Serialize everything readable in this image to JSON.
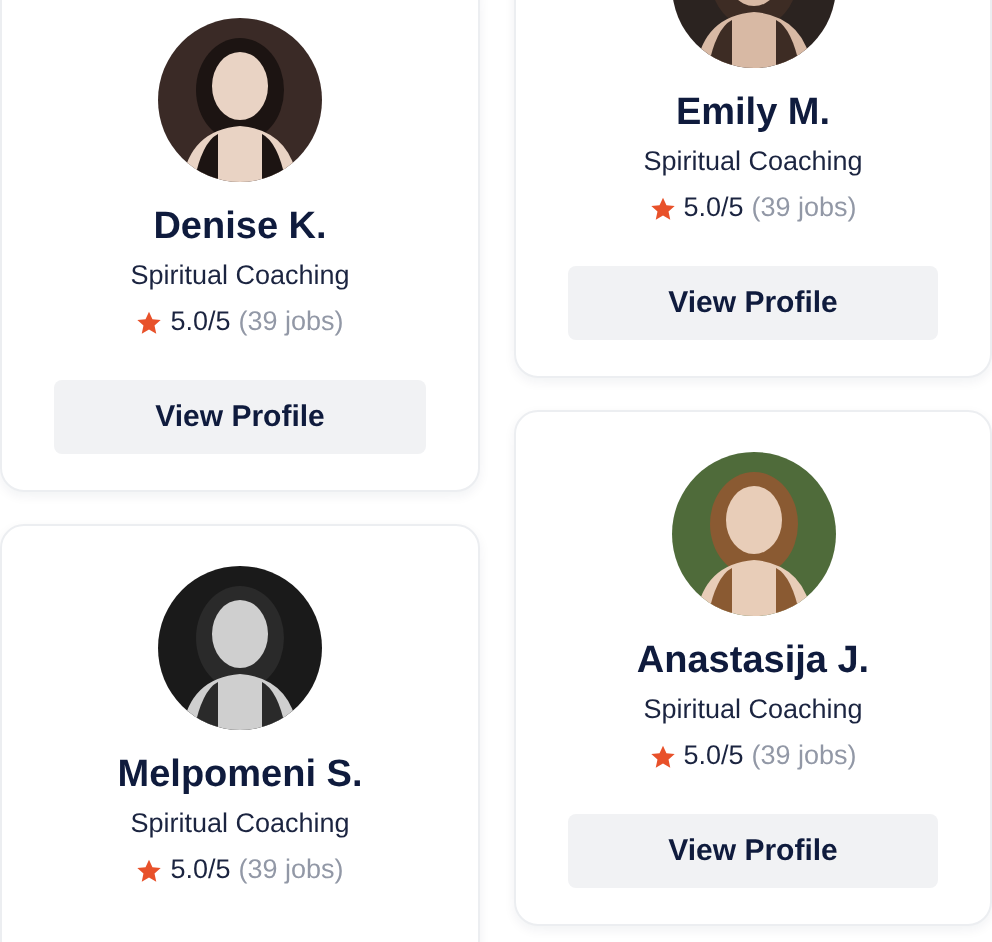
{
  "columns": [
    {
      "cards": [
        {
          "name": "Denise K.",
          "specialty": "Spiritual Coaching",
          "rating": "5.0/5",
          "jobs": "(39 jobs)",
          "button": "View Profile"
        },
        {
          "name": "Melpomeni S.",
          "specialty": "Spiritual Coaching",
          "rating": "5.0/5",
          "jobs": "(39 jobs)"
        }
      ]
    },
    {
      "cards": [
        {
          "name": "Emily M.",
          "specialty": "Spiritual Coaching",
          "rating": "5.0/5",
          "jobs": "(39 jobs)",
          "button": "View Profile"
        },
        {
          "name": "Anastasija J.",
          "specialty": "Spiritual Coaching",
          "rating": "5.0/5",
          "jobs": "(39 jobs)",
          "button": "View Profile"
        }
      ]
    }
  ]
}
